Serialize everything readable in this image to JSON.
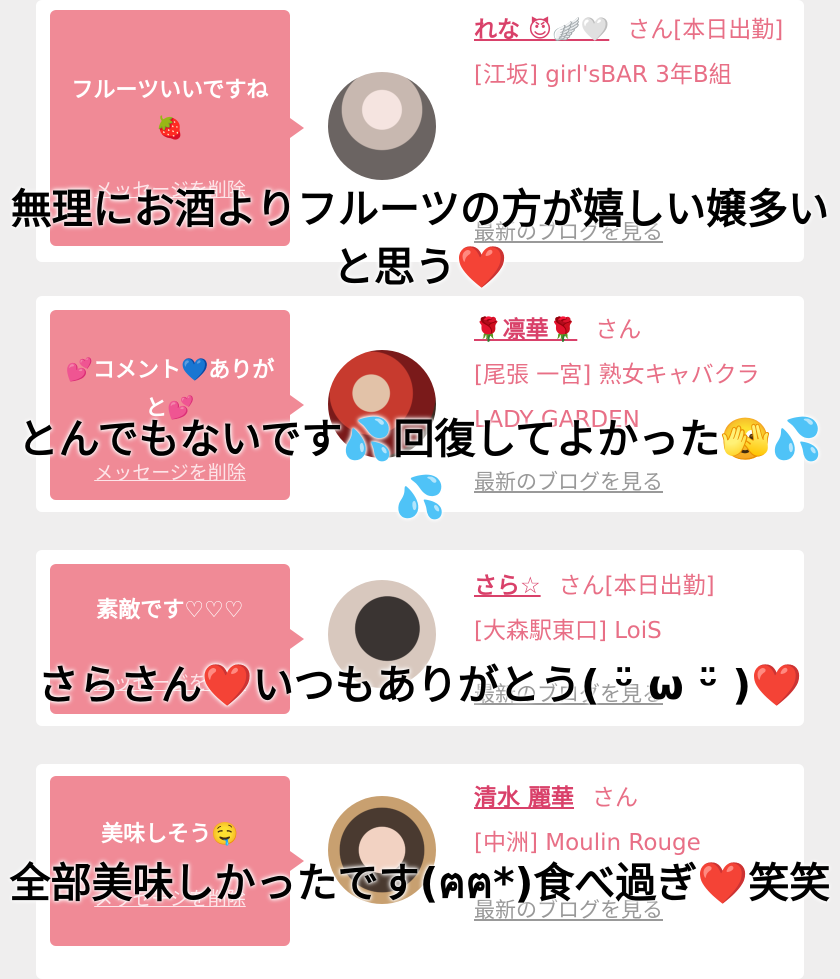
{
  "colors": {
    "bubble": "#f08a96",
    "name": "#d9416a",
    "meta": "#e86f86",
    "background": "#efeeee"
  },
  "cards": [
    {
      "message": "フルーツいいですね🍓",
      "delete_label": "メッセージを削除",
      "name": "れな 😈🪽🤍",
      "suffix": "さん[本日出勤]",
      "shop": "[江坂] girl'sBAR 3年B組",
      "blog_link": "最新のブログを見る"
    },
    {
      "message": "💕コメント💙ありがと💕",
      "delete_label": "メッセージを削除",
      "name": "🌹凛華🌹",
      "suffix": "さん",
      "shop": "[尾張 一宮] 熟女キャバクラ LADY GARDEN",
      "blog_link": "最新のブログを見る"
    },
    {
      "message": "素敵です♡♡♡",
      "delete_label": "メッセージを削除",
      "name": "さら☆",
      "suffix": "さん[本日出勤]",
      "shop": "[大森駅東口] LoiS",
      "blog_link": "最新のブログを見る"
    },
    {
      "message": "美味しそう🤤",
      "delete_label": "メッセージを削除",
      "name": "清水 麗華",
      "suffix": "さん",
      "shop": "[中洲] Moulin Rouge",
      "blog_link": "最新のブログを見る"
    }
  ],
  "captions": [
    "無理にお酒よりフルーツの方が嬉しい嬢多いと思う❤️",
    "とんでもないです💦回復してよかった🫣💦💦",
    "さらさん❤️いつもありがとう( ᵕ̈ ω ᵕ̈ )❤️",
    "全部美味しかったです(ฅฅ*)食べ過ぎ❤️笑笑"
  ]
}
